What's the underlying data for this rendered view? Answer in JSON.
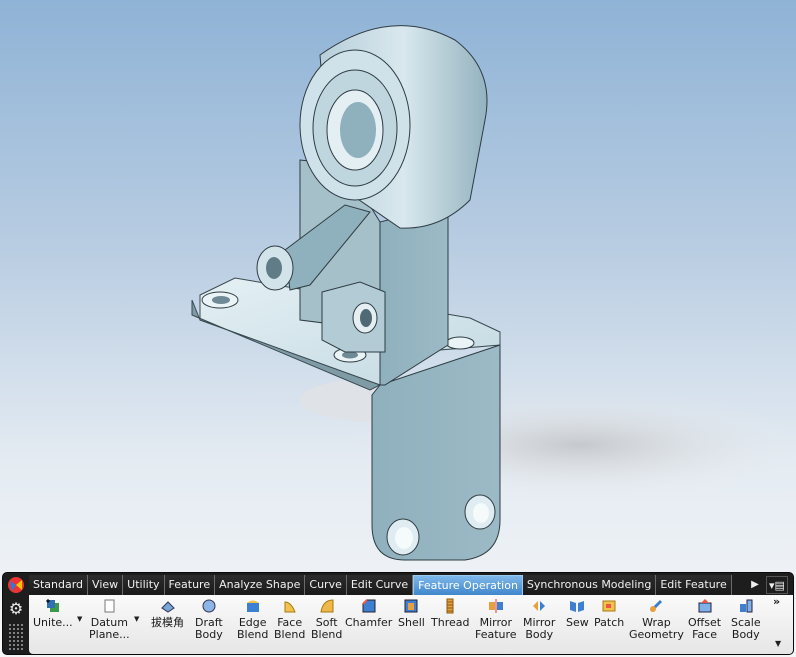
{
  "viewport": {
    "model": "3D bracket part"
  },
  "ribbon": {
    "tabs": [
      "Standard",
      "View",
      "Utility",
      "Feature",
      "Analyze Shape",
      "Curve",
      "Edit Curve",
      "Feature Operation",
      "Synchronous Modeling",
      "Edit Feature"
    ],
    "active_tab": "Feature Operation",
    "commands": {
      "unite": {
        "l1": "Unite...",
        "l2": ""
      },
      "datum": {
        "l1": "Datum",
        "l2": "Plane..."
      },
      "draft_cn": {
        "l1": "拔模角",
        "l2": ""
      },
      "draft_body": {
        "l1": "Draft",
        "l2": "Body"
      },
      "edge_blend": {
        "l1": "Edge",
        "l2": "Blend"
      },
      "face_blend": {
        "l1": "Face",
        "l2": "Blend"
      },
      "soft_blend": {
        "l1": "Soft",
        "l2": "Blend"
      },
      "chamfer": {
        "l1": "Chamfer",
        "l2": ""
      },
      "shell": {
        "l1": "Shell",
        "l2": ""
      },
      "thread": {
        "l1": "Thread",
        "l2": ""
      },
      "mirror_feature": {
        "l1": "Mirror",
        "l2": "Feature"
      },
      "mirror_body": {
        "l1": "Mirror",
        "l2": "Body"
      },
      "sew": {
        "l1": "Sew",
        "l2": ""
      },
      "patch": {
        "l1": "Patch",
        "l2": ""
      },
      "wrap_geometry": {
        "l1": "Wrap",
        "l2": "Geometry"
      },
      "offset_face": {
        "l1": "Offset",
        "l2": "Face"
      },
      "scale_body": {
        "l1": "Scale",
        "l2": "Body"
      }
    },
    "more": "»"
  },
  "colors": {
    "accent": "#3f86cc",
    "part": "#b9d3dd",
    "ribbon_dark": "#1d1d1d"
  }
}
